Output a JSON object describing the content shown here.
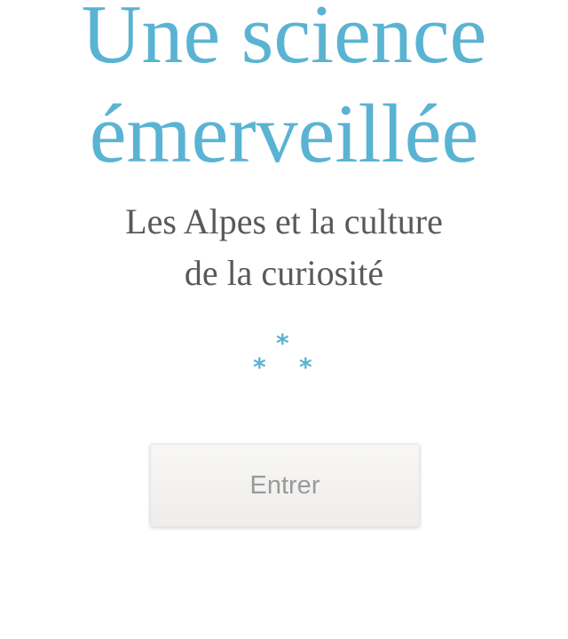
{
  "title": {
    "line1": "Une science",
    "line2": "émerveillée"
  },
  "subtitle": {
    "line1": "Les Alpes et la culture",
    "line2": "de la curiosité"
  },
  "asterism": {
    "glyph": "*",
    "color": "#5ab3d3"
  },
  "enter_button": {
    "label": "Entrer"
  },
  "colors": {
    "accent": "#5ab3d3",
    "subtitle_text": "#58595b",
    "button_text": "#9a9a9a",
    "background": "#ffffff"
  }
}
